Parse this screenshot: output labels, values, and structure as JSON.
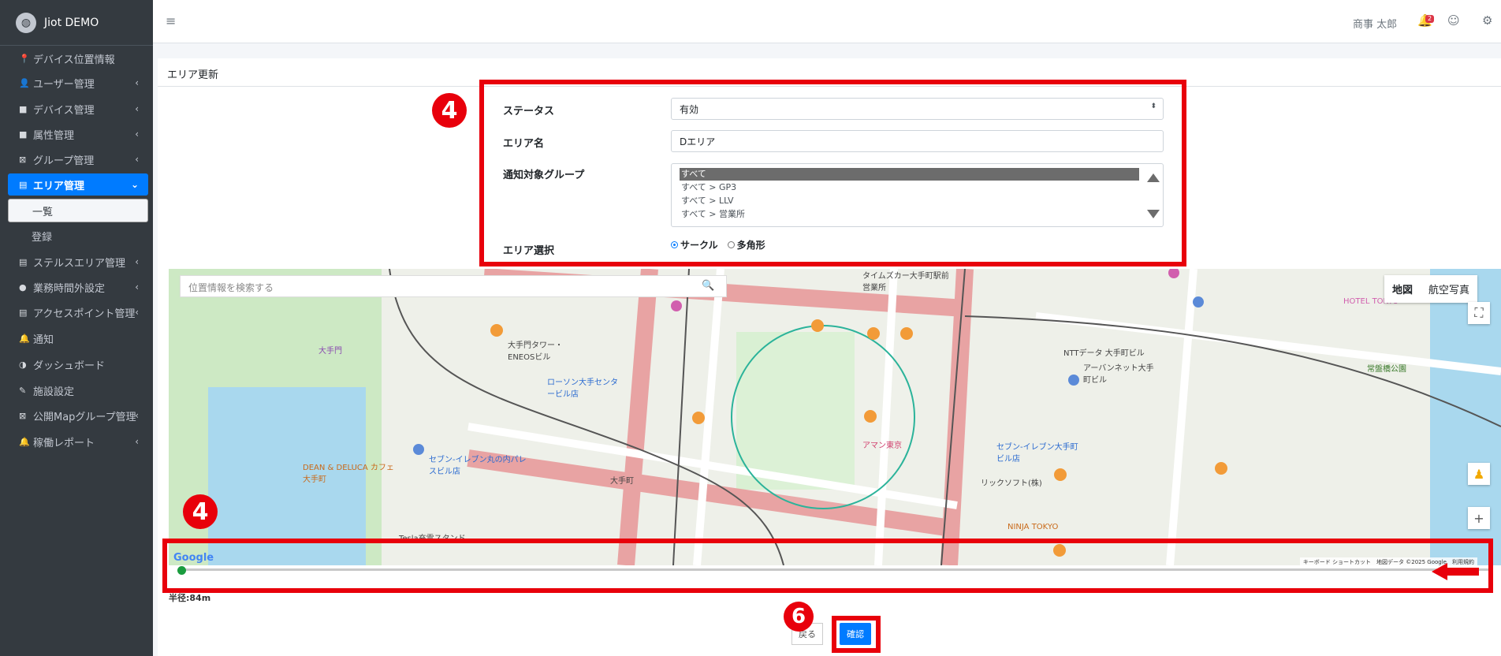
{
  "app": {
    "title": "Jiot DEMO",
    "logo_icon": "globe-icon"
  },
  "sidebar": {
    "items": [
      {
        "label": "デバイス位置情報",
        "icon": "map-marker-icon"
      },
      {
        "label": "ユーザー管理",
        "icon": "user-icon"
      },
      {
        "label": "デバイス管理",
        "icon": "device-icon"
      },
      {
        "label": "属性管理",
        "icon": "list-icon"
      },
      {
        "label": "グループ管理",
        "icon": "group-icon"
      },
      {
        "label": "エリア管理",
        "icon": "map-icon"
      },
      {
        "label": "ステルスエリア管理",
        "icon": "map-icon"
      },
      {
        "label": "業務時間外設定",
        "icon": "clock-icon"
      },
      {
        "label": "アクセスポイント管理",
        "icon": "map-icon"
      },
      {
        "label": "通知",
        "icon": "bell-icon"
      },
      {
        "label": "ダッシュボード",
        "icon": "dashboard-icon"
      },
      {
        "label": "施設設定",
        "icon": "wrench-icon"
      },
      {
        "label": "公開Mapグループ管理",
        "icon": "group-icon"
      },
      {
        "label": "稼働レポート",
        "icon": "bell-icon"
      }
    ],
    "sub": {
      "list": "一覧",
      "register": "登録"
    }
  },
  "topbar": {
    "user_name": "商事 太郎",
    "notif_count": "2"
  },
  "card": {
    "title": "エリア更新"
  },
  "form": {
    "status_label": "ステータス",
    "status_value": "有効",
    "name_label": "エリア名",
    "name_value": "Dエリア",
    "group_label": "通知対象グループ",
    "group_options": [
      "すべて",
      "すべて > GP3",
      "すべて > LLV",
      "すべて > 営業所"
    ],
    "area_select_label": "エリア選択",
    "area_options": [
      "サークル",
      "多角形"
    ]
  },
  "map": {
    "search_placeholder": "位置情報を検索する",
    "type_map": "地図",
    "type_satellite": "航空写真",
    "google": "Google",
    "attribution": "キーボード ショートカット　地図データ ©2025 Google　利用規約",
    "labels": {
      "l1": "大手門",
      "l2": "大手門タワー・ENEOSビル",
      "l3": "ローソン大手センタービル店",
      "l4": "セブン-イレブン丸の内パレスビル店",
      "l5": "NTTデータ 大手町ビル",
      "l6": "アーバンネット大手町ビル",
      "l7": "アマン東京",
      "l8": "セブン-イレブン大手町ビル店",
      "l9": "リックソフト(株)",
      "l10": "NINJA TOKYO",
      "l11": "DEAN & DELUCA カフェ 大手町",
      "l12": "HOTEL TOKYO",
      "l13": "常盤橋公園",
      "l14": "Tesla充電スタンド",
      "l15": "大手町",
      "l16": "タイムズカー大手町駅前営業所"
    }
  },
  "radius_text": "半径:84m",
  "buttons": {
    "back": "戻る",
    "confirm": "確認"
  },
  "annotations": {
    "a1": "4",
    "a2": "4",
    "a3": "6"
  },
  "colors": {
    "accent": "#007bff",
    "annotation_red": "#e8000b",
    "sidebar_bg": "#343a40"
  }
}
